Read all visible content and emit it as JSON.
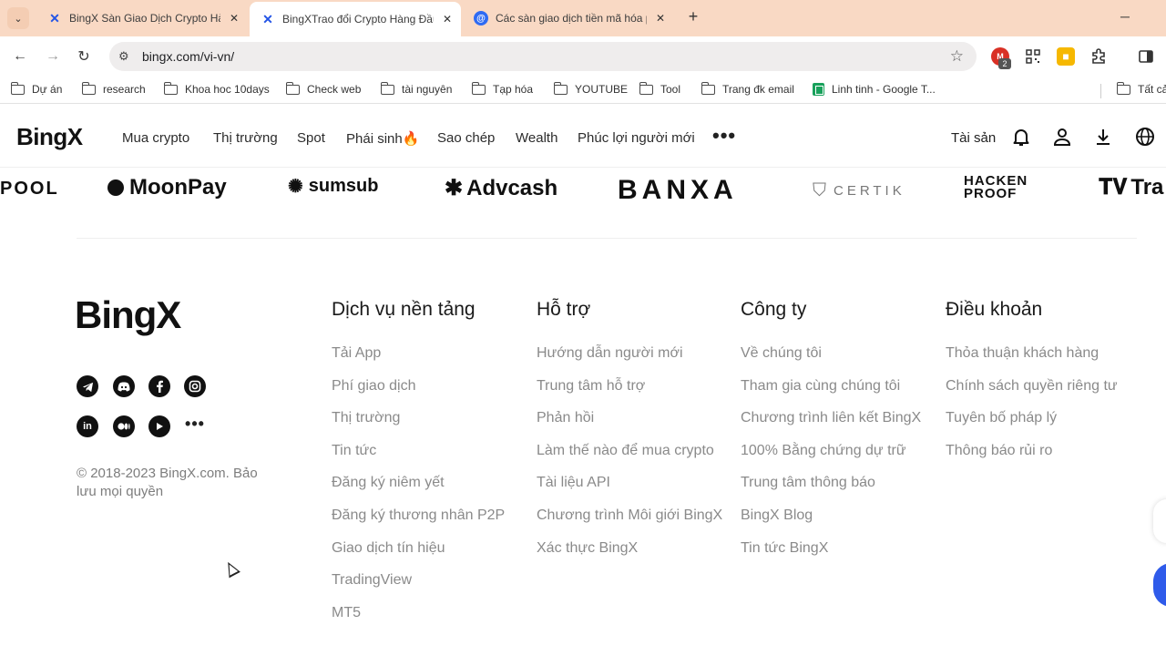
{
  "browser": {
    "tabs": [
      {
        "label": "BingX Sàn Giao Dịch Crypto Hà",
        "favicon": "bingx-icon",
        "active": false
      },
      {
        "label": "BingXTrao đổi Crypto Hàng Đầu",
        "favicon": "bingx-icon",
        "active": true
      },
      {
        "label": "Các sàn giao dịch tiền mã hóa p",
        "favicon": "at-icon",
        "active": false
      }
    ],
    "new_tab": "+",
    "url": "bingx.com/vi-vn/",
    "extension_badge": "2",
    "bookmarks": [
      {
        "label": "Dự án",
        "icon": "folder-icon"
      },
      {
        "label": "research",
        "icon": "folder-icon"
      },
      {
        "label": "Khoa hoc 10days",
        "icon": "folder-icon"
      },
      {
        "label": "Check web",
        "icon": "folder-icon"
      },
      {
        "label": "tài nguyên",
        "icon": "folder-icon"
      },
      {
        "label": "Tạp hóa",
        "icon": "folder-icon"
      },
      {
        "label": "YOUTUBE",
        "icon": "folder-icon"
      },
      {
        "label": "Tool",
        "icon": "folder-icon"
      },
      {
        "label": "Trang đk email",
        "icon": "folder-icon"
      },
      {
        "label": "Linh tinh - Google T...",
        "icon": "sheets-icon"
      },
      {
        "label": "Tất cả",
        "icon": "folder-icon"
      }
    ]
  },
  "site": {
    "logo": "BingX",
    "nav": [
      "Mua crypto",
      "Thị trường",
      "Spot",
      "Phái sinh🔥",
      "Sao chép",
      "Wealth",
      "Phúc lợi người mới"
    ],
    "more": "•••",
    "assets": "Tài sản"
  },
  "partners": [
    "POOL",
    "MoonPay",
    "sumsub",
    "Advcash",
    "BANXA",
    "CERTIK",
    "HACKEN",
    "PROOF",
    "Tra"
  ],
  "footer": {
    "logo": "BingX",
    "copyright": "© 2018-2023 BingX.com. Bảo lưu mọi quyền",
    "columns": [
      {
        "title": "Dịch vụ nền tảng",
        "links": [
          "Tải App",
          "Phí giao dịch",
          "Thị trường",
          "Tin tức",
          "Đăng ký niêm yết",
          "Đăng ký thương nhân P2P",
          "Giao dịch tín hiệu",
          "TradingView",
          "MT5"
        ]
      },
      {
        "title": "Hỗ trợ",
        "links": [
          "Hướng dẫn người mới",
          "Trung tâm hỗ trợ",
          "Phản hồi",
          "Làm thế nào để mua crypto",
          "Tài liệu API",
          "Chương trình Môi giới BingX",
          "Xác thực BingX"
        ]
      },
      {
        "title": "Công ty",
        "links": [
          "Về chúng tôi",
          "Tham gia cùng chúng tôi",
          "Chương trình liên kết BingX",
          "100% Bằng chứng dự trữ",
          "Trung tâm thông báo",
          "BingX Blog",
          "Tin tức BingX"
        ]
      },
      {
        "title": "Điều khoản",
        "links": [
          "Thỏa thuận khách hàng",
          "Chính sách quyền riêng tư",
          "Tuyên bố pháp lý",
          "Thông báo rủi ro"
        ]
      }
    ],
    "social_more": "•••"
  },
  "colors": {
    "tabstrip": "#f9d9c4",
    "accent": "#2f5bea",
    "link_gray": "#8a8a8a"
  }
}
